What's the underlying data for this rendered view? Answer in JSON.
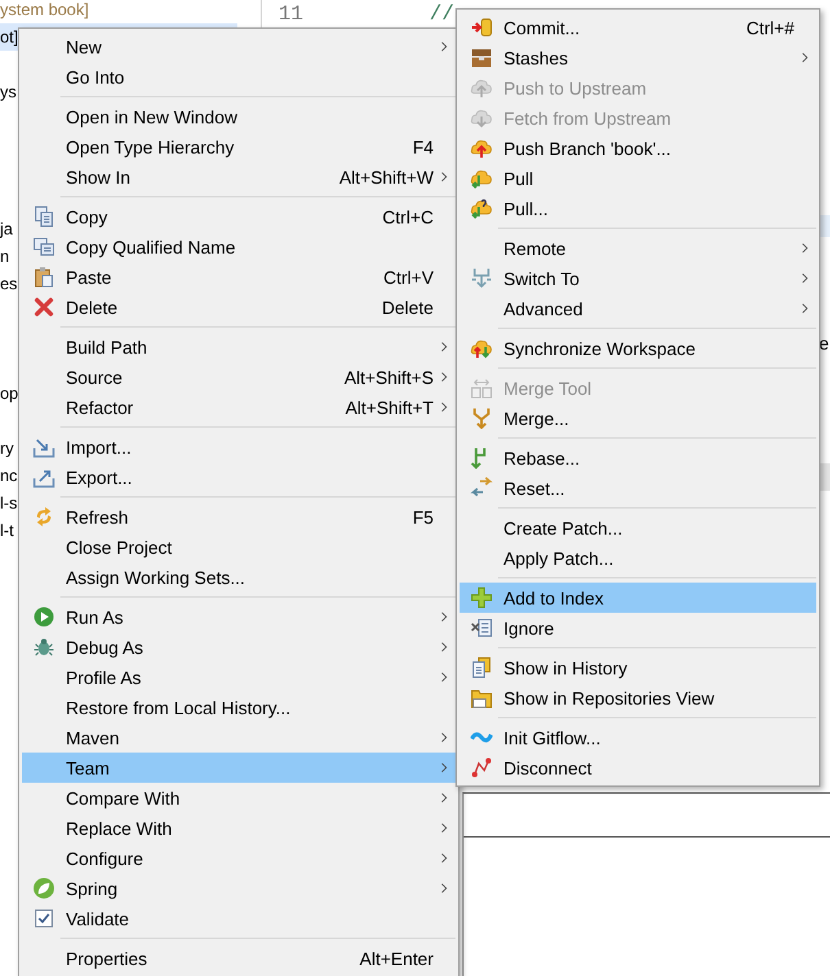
{
  "explorer": {
    "rows": [
      {
        "label": "ystem book]",
        "kind": "repo",
        "selected": false
      },
      {
        "label": "ot]",
        "kind": "file",
        "selected": true
      },
      {
        "label": "ys",
        "kind": "file",
        "selected": false
      },
      {
        "label": "ja",
        "kind": "file",
        "selected": false
      },
      {
        "label": "n",
        "kind": "file",
        "selected": false
      },
      {
        "label": "es",
        "kind": "file",
        "selected": false
      },
      {
        "label": "op",
        "kind": "file",
        "selected": false
      },
      {
        "label": "ry",
        "kind": "file",
        "selected": false
      },
      {
        "label": "nc",
        "kind": "file",
        "selected": false
      },
      {
        "label": "l-s",
        "kind": "file",
        "selected": false
      },
      {
        "label": "l-t",
        "kind": "file",
        "selected": false
      }
    ]
  },
  "editor": {
    "lines": [
      {
        "number": "11",
        "code": "    //"
      }
    ],
    "side_text": "e"
  },
  "main_menu": {
    "groups": [
      {
        "items": [
          {
            "label": "New",
            "submenu": true,
            "selected": false
          },
          {
            "label": "Go Into",
            "submenu": false,
            "selected": false
          }
        ]
      },
      {
        "items": [
          {
            "label": "Open in New Window",
            "submenu": false,
            "selected": false
          },
          {
            "label": "Open Type Hierarchy",
            "shortcut": "F4",
            "submenu": false,
            "selected": false
          },
          {
            "label": "Show In",
            "shortcut": "Alt+Shift+W",
            "submenu": true,
            "selected": false
          }
        ]
      },
      {
        "items": [
          {
            "label": "Copy",
            "shortcut": "Ctrl+C",
            "submenu": false,
            "selected": false
          },
          {
            "label": "Copy Qualified Name",
            "submenu": false,
            "selected": false
          },
          {
            "label": "Paste",
            "shortcut": "Ctrl+V",
            "submenu": false,
            "selected": false
          },
          {
            "label": "Delete",
            "shortcut": "Delete",
            "submenu": false,
            "selected": false
          }
        ]
      },
      {
        "items": [
          {
            "label": "Build Path",
            "submenu": true,
            "selected": false
          },
          {
            "label": "Source",
            "shortcut": "Alt+Shift+S",
            "submenu": true,
            "selected": false
          },
          {
            "label": "Refactor",
            "shortcut": "Alt+Shift+T",
            "submenu": true,
            "selected": false
          }
        ]
      },
      {
        "items": [
          {
            "label": "Import...",
            "submenu": false,
            "selected": false
          },
          {
            "label": "Export...",
            "submenu": false,
            "selected": false
          }
        ]
      },
      {
        "items": [
          {
            "label": "Refresh",
            "shortcut": "F5",
            "submenu": false,
            "selected": false
          },
          {
            "label": "Close Project",
            "submenu": false,
            "selected": false
          },
          {
            "label": "Assign Working Sets...",
            "submenu": false,
            "selected": false
          }
        ]
      },
      {
        "items": [
          {
            "label": "Run As",
            "submenu": true,
            "selected": false
          },
          {
            "label": "Debug As",
            "submenu": true,
            "selected": false
          },
          {
            "label": "Profile As",
            "submenu": true,
            "selected": false
          },
          {
            "label": "Restore from Local History...",
            "submenu": false,
            "selected": false
          },
          {
            "label": "Maven",
            "submenu": true,
            "selected": false
          },
          {
            "label": "Team",
            "submenu": true,
            "selected": true
          },
          {
            "label": "Compare With",
            "submenu": true,
            "selected": false
          },
          {
            "label": "Replace With",
            "submenu": true,
            "selected": false
          },
          {
            "label": "Configure",
            "submenu": true,
            "selected": false
          },
          {
            "label": "Spring",
            "submenu": true,
            "selected": false
          },
          {
            "label": "Validate",
            "submenu": false,
            "selected": false
          }
        ]
      },
      {
        "items": [
          {
            "label": "Properties",
            "shortcut": "Alt+Enter",
            "submenu": false,
            "selected": false
          }
        ]
      }
    ]
  },
  "team_menu": {
    "groups": [
      {
        "items": [
          {
            "label": "Commit...",
            "shortcut": "Ctrl+#",
            "submenu": false,
            "selected": false,
            "disabled": false
          },
          {
            "label": "Stashes",
            "submenu": true,
            "selected": false,
            "disabled": false
          },
          {
            "label": "Push to Upstream",
            "submenu": false,
            "selected": false,
            "disabled": true
          },
          {
            "label": "Fetch from Upstream",
            "submenu": false,
            "selected": false,
            "disabled": true
          },
          {
            "label": "Push Branch 'book'...",
            "submenu": false,
            "selected": false,
            "disabled": false
          },
          {
            "label": "Pull",
            "submenu": false,
            "selected": false,
            "disabled": false
          },
          {
            "label": "Pull...",
            "submenu": false,
            "selected": false,
            "disabled": false
          }
        ]
      },
      {
        "items": [
          {
            "label": "Remote",
            "submenu": true,
            "selected": false,
            "disabled": false
          },
          {
            "label": "Switch To",
            "submenu": true,
            "selected": false,
            "disabled": false
          },
          {
            "label": "Advanced",
            "submenu": true,
            "selected": false,
            "disabled": false
          }
        ]
      },
      {
        "items": [
          {
            "label": "Synchronize Workspace",
            "submenu": false,
            "selected": false,
            "disabled": false
          }
        ]
      },
      {
        "items": [
          {
            "label": "Merge Tool",
            "submenu": false,
            "selected": false,
            "disabled": true
          },
          {
            "label": "Merge...",
            "submenu": false,
            "selected": false,
            "disabled": false
          }
        ]
      },
      {
        "items": [
          {
            "label": "Rebase...",
            "submenu": false,
            "selected": false,
            "disabled": false
          },
          {
            "label": "Reset...",
            "submenu": false,
            "selected": false,
            "disabled": false
          }
        ]
      },
      {
        "items": [
          {
            "label": "Create Patch...",
            "submenu": false,
            "selected": false,
            "disabled": false
          },
          {
            "label": "Apply Patch...",
            "submenu": false,
            "selected": false,
            "disabled": false
          }
        ]
      },
      {
        "items": [
          {
            "label": "Add to Index",
            "submenu": false,
            "selected": true,
            "disabled": false
          },
          {
            "label": "Ignore",
            "submenu": false,
            "selected": false,
            "disabled": false
          }
        ]
      },
      {
        "items": [
          {
            "label": "Show in History",
            "submenu": false,
            "selected": false,
            "disabled": false
          },
          {
            "label": "Show in Repositories View",
            "submenu": false,
            "selected": false,
            "disabled": false
          }
        ]
      },
      {
        "items": [
          {
            "label": "Init Gitflow...",
            "submenu": false,
            "selected": false,
            "disabled": false
          },
          {
            "label": "Disconnect",
            "submenu": false,
            "selected": false,
            "disabled": false
          }
        ]
      }
    ]
  }
}
